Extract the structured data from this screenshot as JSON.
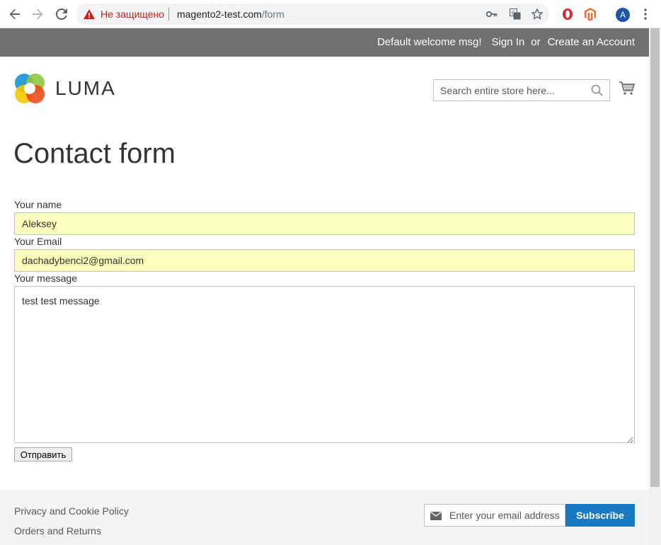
{
  "browser": {
    "security_text": "Не защищено",
    "url_host": "magento2-test.com",
    "url_path": "/form",
    "profile_initial": "A",
    "icons": [
      "back-arrow-icon",
      "forward-arrow-icon",
      "reload-icon",
      "warning-icon",
      "key-icon",
      "translate-icon",
      "star-icon",
      "opera-icon",
      "magento-icon",
      "menu-icon"
    ]
  },
  "header": {
    "welcome": "Default welcome msg!",
    "sign_in": "Sign In",
    "or": "or",
    "create_account": "Create an Account",
    "logo_text": "LUMA",
    "search_placeholder": "Search entire store here..."
  },
  "main": {
    "title": "Contact form",
    "name_label": "Your name",
    "name_value": "Aleksey",
    "email_label": "Your Email",
    "email_value": "dachadybenci2@gmail.com",
    "message_label": "Your message",
    "message_value": "test test message",
    "submit_label": "Отправить"
  },
  "footer": {
    "links": [
      "Privacy and Cookie Policy",
      "Orders and Returns"
    ],
    "newsletter_placeholder": "Enter your email address",
    "subscribe_label": "Subscribe"
  },
  "colors": {
    "panel_bg": "#6e716e",
    "autofill_bg": "#faffbd",
    "subscribe_bg": "#1979c3",
    "footer_bg": "#f4f4f4"
  }
}
